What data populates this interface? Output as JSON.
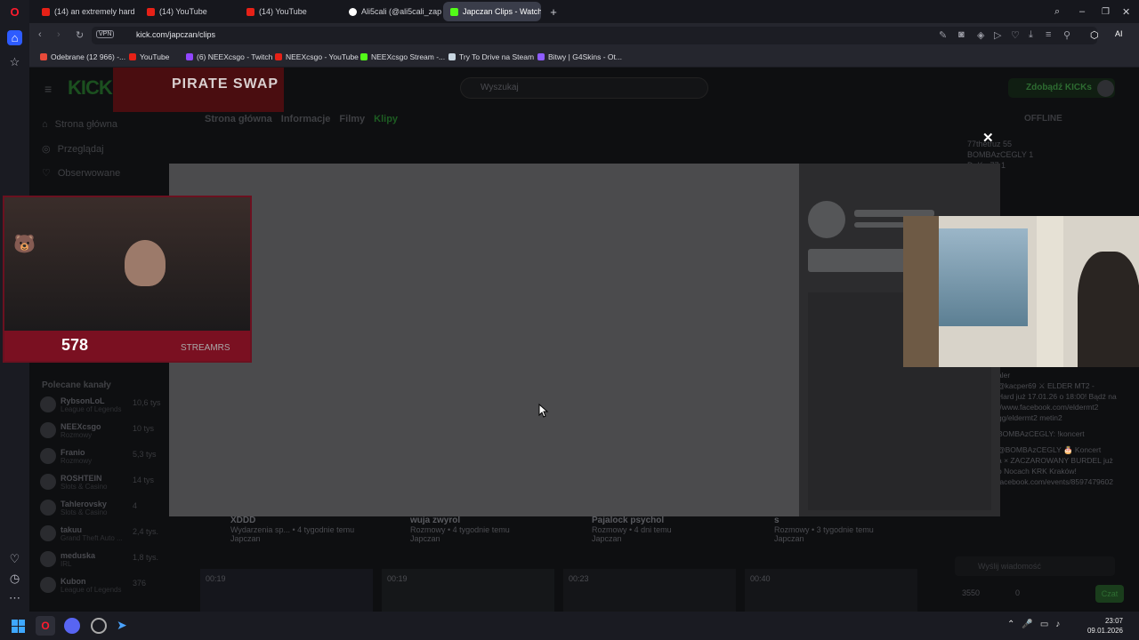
{
  "browser": {
    "tabs": [
      {
        "label": "(14) an extremely hard ga",
        "color": "#e62117"
      },
      {
        "label": "(14) YouTube",
        "color": "#e62117"
      },
      {
        "label": "(14) YouTube",
        "color": "#e62117"
      },
      {
        "label": "Ali5cali (@ali5cali_zapaso",
        "color": "#ffffff"
      },
      {
        "label": "Japczan Clips - Watch Live",
        "color": "#53fc18"
      }
    ],
    "url": "kick.com/japczan/clips",
    "vpn": "VPN",
    "ai_label": "AI",
    "bookmarks": [
      {
        "label": "Odebrane (12 966) -...",
        "color": "#e84a3a"
      },
      {
        "label": "YouTube",
        "color": "#e62117"
      },
      {
        "label": "(6) NEEXcsgo - Twitch",
        "color": "#9146ff"
      },
      {
        "label": "NEEXcsgo - YouTube",
        "color": "#e62117"
      },
      {
        "label": "NEEXcsgo Stream -...",
        "color": "#53fc18"
      },
      {
        "label": "Try To Drive na Steam",
        "color": "#c7d5e0"
      },
      {
        "label": "Bitwy | G4Skins - Ot...",
        "color": "#8e5cff"
      }
    ]
  },
  "kick": {
    "logo": "KICK",
    "banner": "PIRATE SWAP",
    "search_placeholder": "Wyszukaj",
    "get_kicks": "Zdobądź KICKs",
    "nav": [
      "Strona główna",
      "Przeglądaj",
      "Obserwowane"
    ],
    "page_tabs": [
      "Strona główna",
      "Informacje",
      "Filmy",
      "Klipy"
    ],
    "offline": "OFFLINE",
    "recommended_title": "Polecane kanały",
    "channels": [
      {
        "name": "RybsonLoL",
        "cat": "League of Legends",
        "count": "10,6 tys"
      },
      {
        "name": "NEEXcsgo",
        "cat": "Rozmowy",
        "count": "10 tys"
      },
      {
        "name": "Franio",
        "cat": "Rozmowy",
        "count": "5,3 tys"
      },
      {
        "name": "ROSHTEIN",
        "cat": "Slots & Casino",
        "count": "14 tys"
      },
      {
        "name": "Tahlerovsky",
        "cat": "Slots & Casino",
        "count": "4"
      },
      {
        "name": "takuu",
        "cat": "Grand Theft Auto ...",
        "count": "2,4 tys."
      },
      {
        "name": "meduska",
        "cat": "IRL",
        "count": "1,8 tys."
      },
      {
        "name": "Kubon",
        "cat": "League of Legends",
        "count": "376"
      }
    ],
    "clips": [
      {
        "title": "XDDD",
        "meta": "Wydarzenia sp... • 4 tygodnie temu",
        "author": "Japczan"
      },
      {
        "title": "wuja zwyrol",
        "meta": "Rozmowy • 4 tygodnie temu",
        "author": "Japczan"
      },
      {
        "title": "Pajalock psychol",
        "meta": "Rozmowy • 4 dni temu",
        "author": "Japczan"
      },
      {
        "title": "s",
        "meta": "Rozmowy • 3 tygodnie temu",
        "author": "Japczan"
      }
    ],
    "durations": [
      "00:19",
      "00:19",
      "00:23",
      "00:40"
    ],
    "chat": {
      "top_users": [
        "77thetruz",
        "BOMBAzCEGLY",
        "DeKar77"
      ],
      "top_counts": [
        "55",
        "1",
        "1"
      ],
      "lines": [
        "dzie streama",
        "Hard już 17.01.26 o 18:00! Bądź na",
        "//www.facebook.com/eldermt2",
        "gg/eldermt2 metin2",
        "@kacper69 ⚔ ELDER MT2 -",
        "BOMBAzCEGLY: !koncert",
        "@BOMBAzCEGLY 🎂 Koncert",
        "a × ZACZAROWANY BURDEL już",
        "o Nocach KRK Kraków!",
        "facebook.com/events/8597479602",
        "aler"
      ],
      "input_placeholder": "Wyślij wiadomość",
      "kicks": "3550",
      "zero": "0",
      "send": "Czat"
    }
  },
  "cams": {
    "left_label": "STREAMRS",
    "left_badge": "578"
  },
  "taskbar": {
    "time": "23:07",
    "date": "09.01.2026"
  }
}
